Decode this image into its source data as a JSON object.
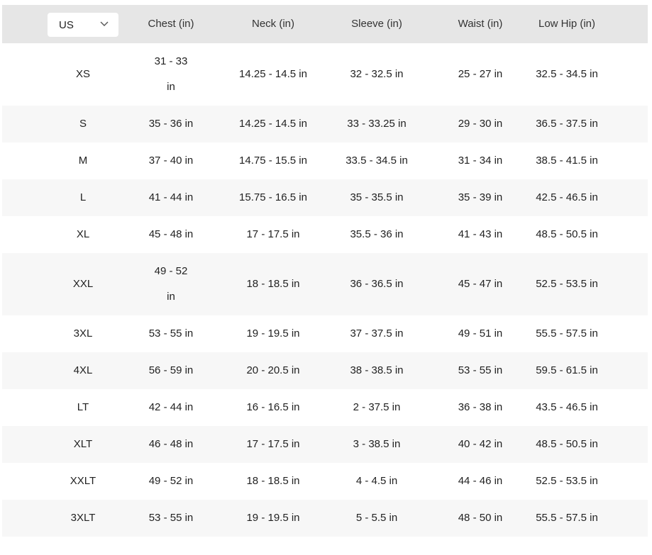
{
  "region_select": {
    "value": "US"
  },
  "headers": [
    "Chest (in)",
    "Neck (in)",
    "Sleeve (in)",
    "Waist (in)",
    "Low Hip (in)"
  ],
  "rows": [
    {
      "size": "XS",
      "chest": "31 - 33 in",
      "neck": "14.25 - 14.5 in",
      "sleeve": "32 - 32.5 in",
      "waist": "25 - 27 in",
      "hip": "32.5 - 34.5 in"
    },
    {
      "size": "S",
      "chest": "35 - 36 in",
      "neck": "14.25 - 14.5 in",
      "sleeve": "33 - 33.25 in",
      "waist": "29 - 30 in",
      "hip": "36.5 - 37.5 in"
    },
    {
      "size": "M",
      "chest": "37 - 40 in",
      "neck": "14.75 - 15.5 in",
      "sleeve": "33.5 - 34.5 in",
      "waist": "31 - 34 in",
      "hip": "38.5 - 41.5 in"
    },
    {
      "size": "L",
      "chest": "41 - 44 in",
      "neck": "15.75 - 16.5 in",
      "sleeve": "35 - 35.5 in",
      "waist": "35 - 39 in",
      "hip": "42.5 - 46.5 in"
    },
    {
      "size": "XL",
      "chest": "45 - 48 in",
      "neck": "17 - 17.5 in",
      "sleeve": "35.5 - 36 in",
      "waist": "41 - 43 in",
      "hip": "48.5 - 50.5 in"
    },
    {
      "size": "XXL",
      "chest": "49 - 52 in",
      "neck": "18 - 18.5 in",
      "sleeve": "36 - 36.5 in",
      "waist": "45 - 47 in",
      "hip": "52.5 - 53.5 in"
    },
    {
      "size": "3XL",
      "chest": "53 - 55 in",
      "neck": "19 - 19.5 in",
      "sleeve": "37 - 37.5 in",
      "waist": "49 - 51 in",
      "hip": "55.5 - 57.5 in"
    },
    {
      "size": "4XL",
      "chest": "56 - 59 in",
      "neck": "20 - 20.5 in",
      "sleeve": "38 - 38.5 in",
      "waist": "53 - 55 in",
      "hip": "59.5 - 61.5 in"
    },
    {
      "size": "LT",
      "chest": "42 - 44 in",
      "neck": "16 - 16.5 in",
      "sleeve": "2 - 37.5 in",
      "waist": "36 - 38 in",
      "hip": "43.5 - 46.5 in"
    },
    {
      "size": "XLT",
      "chest": "46 - 48 in",
      "neck": "17 - 17.5 in",
      "sleeve": "3 - 38.5 in",
      "waist": "40 - 42 in",
      "hip": "48.5 - 50.5 in"
    },
    {
      "size": "XXLT",
      "chest": "49 - 52 in",
      "neck": "18 - 18.5 in",
      "sleeve": "4 - 4.5 in",
      "waist": "44 - 46 in",
      "hip": "52.5 - 53.5 in"
    },
    {
      "size": "3XLT",
      "chest": "53 - 55 in",
      "neck": "19 - 19.5 in",
      "sleeve": "5 - 5.5 in",
      "waist": "48 - 50 in",
      "hip": "55.5 - 57.5 in"
    }
  ]
}
